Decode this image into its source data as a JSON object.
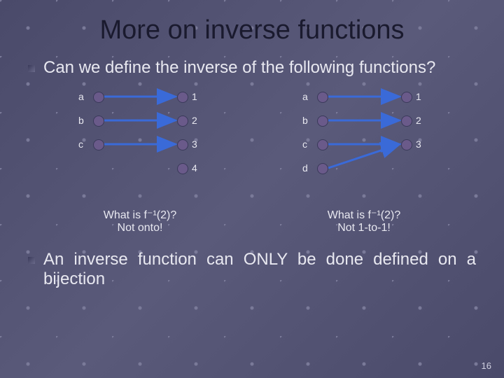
{
  "title": "More on inverse functions",
  "bullet1": "Can we define the inverse of the following functions?",
  "bullet2": "An inverse function can ONLY be done defined on a bijection",
  "diagram_left": {
    "domain": [
      "a",
      "b",
      "c"
    ],
    "codomain": [
      "1",
      "2",
      "3",
      "4"
    ],
    "arrows": [
      [
        0,
        0
      ],
      [
        1,
        1
      ],
      [
        2,
        2
      ]
    ],
    "caption_line1": "What is f⁻¹(2)?",
    "caption_line2": "Not onto!"
  },
  "diagram_right": {
    "domain": [
      "a",
      "b",
      "c",
      "d"
    ],
    "codomain": [
      "1",
      "2",
      "3"
    ],
    "arrows": [
      [
        0,
        0
      ],
      [
        1,
        1
      ],
      [
        2,
        2
      ],
      [
        3,
        2
      ]
    ],
    "caption_line1": "What is f⁻¹(2)?",
    "caption_line2": "Not 1-to-1!"
  },
  "page_number": "16"
}
